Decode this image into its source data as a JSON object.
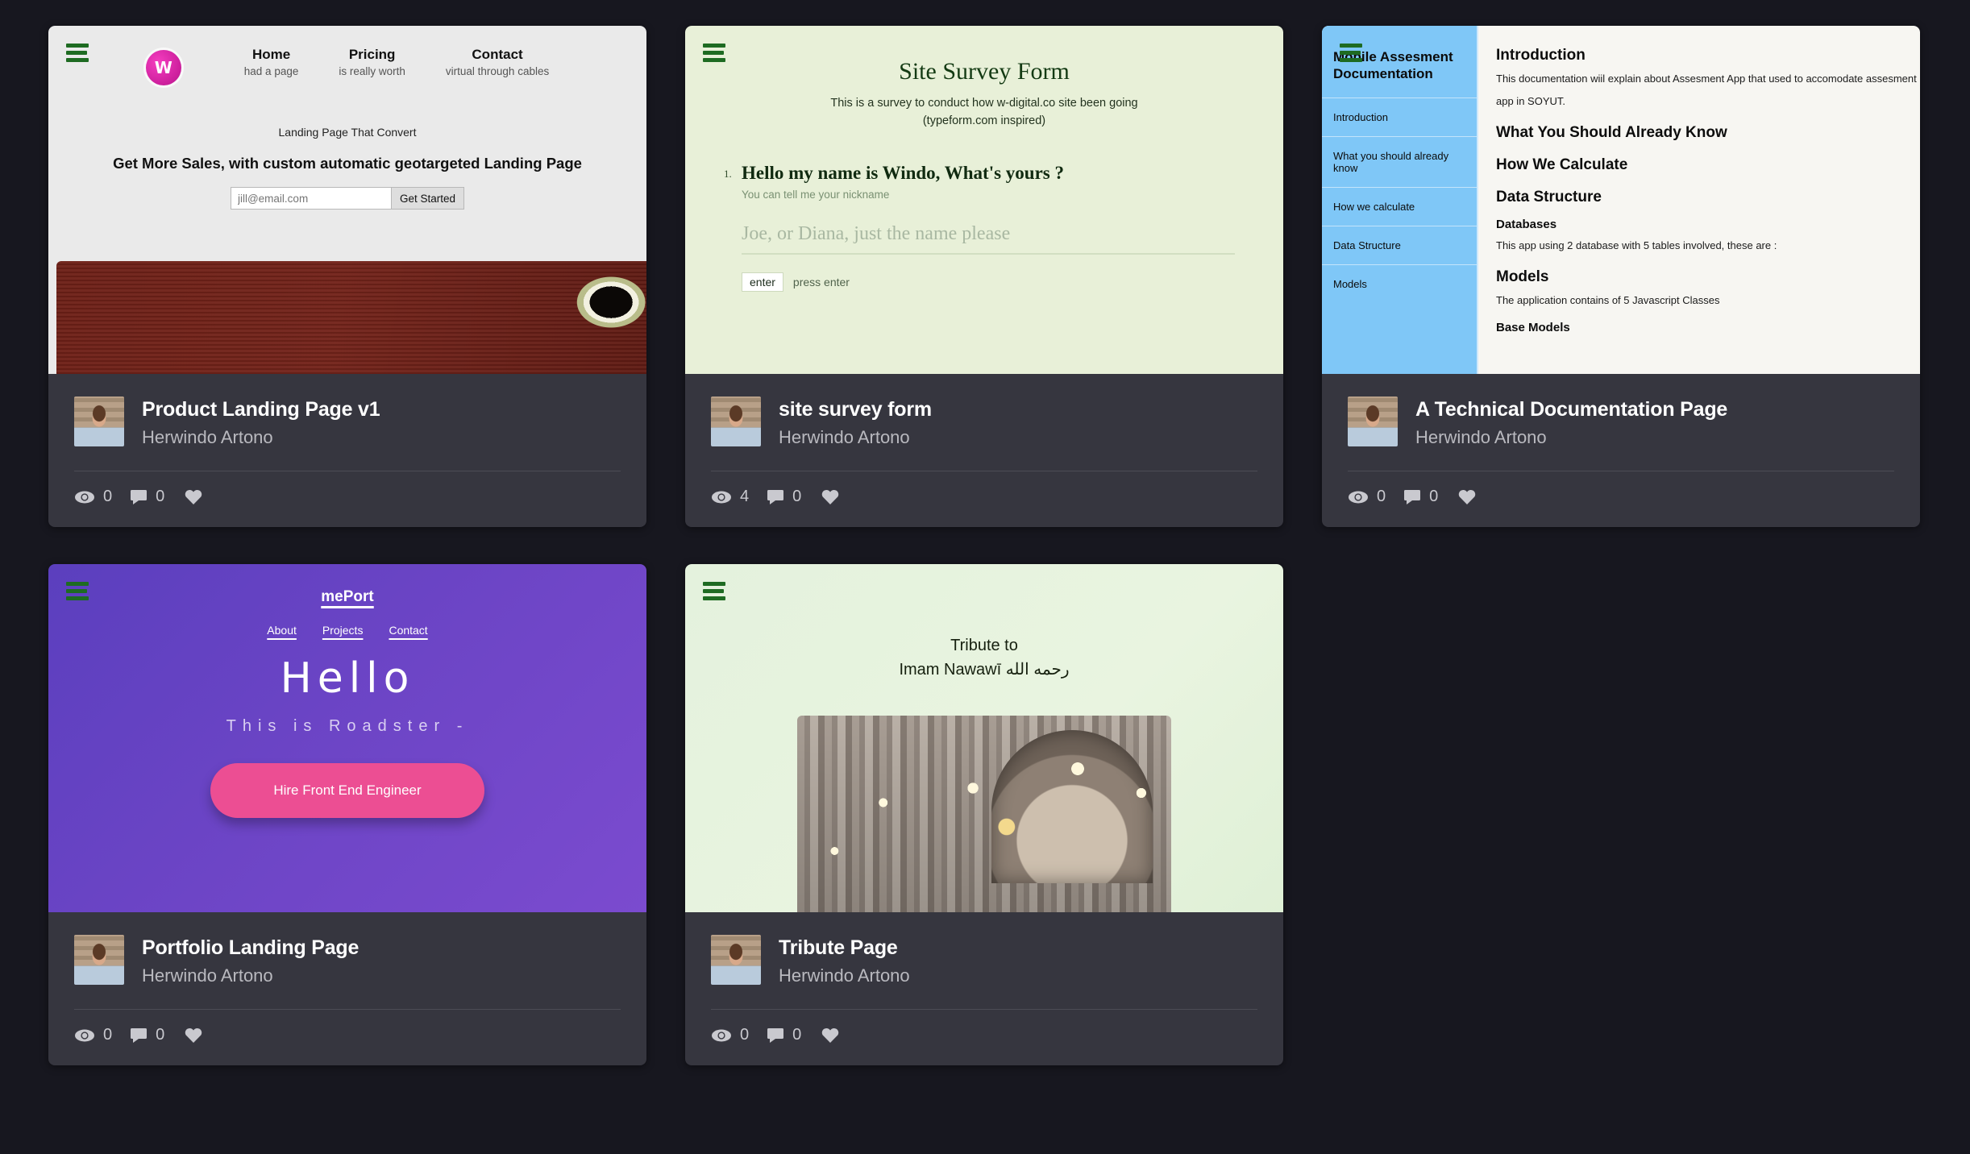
{
  "cards": [
    {
      "id": "product-landing-page-v1",
      "preview": {
        "nav": [
          {
            "label": "Home",
            "sub": "had a page"
          },
          {
            "label": "Pricing",
            "sub": "is really worth"
          },
          {
            "label": "Contact",
            "sub": "virtual through cables"
          }
        ],
        "logo_letter": "W",
        "tagline": "Landing Page That Convert",
        "headline": "Get More Sales, with custom automatic geotargeted Landing Page",
        "email_placeholder": "jill@email.com",
        "cta_label": "Get Started"
      },
      "title": "Product Landing Page v1",
      "author": "Herwindo Artono",
      "views": "0",
      "comments": "0"
    },
    {
      "id": "site-survey-form",
      "preview": {
        "title": "Site Survey Form",
        "subtitle_line1": "This is a survey to conduct how w-digital.co site been going",
        "subtitle_line2": "(typeform.com inspired)",
        "question_number": "1.",
        "question": "Hello my name is Windo, What's yours ?",
        "question_hint": "You can tell me your nickname",
        "answer_placeholder": "Joe, or Diana, just the name please",
        "enter_key": "enter",
        "enter_label": "press enter"
      },
      "title": "site survey form",
      "author": "Herwindo Artono",
      "views": "4",
      "comments": "0"
    },
    {
      "id": "technical-documentation-page",
      "preview": {
        "sidebar_title": "Mobile Assesment Documentation",
        "sidebar_items": [
          "Introduction",
          "What you should already know",
          "How we calculate",
          "Data Structure",
          "Models"
        ],
        "doc_blocks": [
          {
            "style": "h1",
            "text": "Introduction"
          },
          {
            "style": "p",
            "text": "This documentation wiil explain about Assesment App that used to accomodate assesment"
          },
          {
            "style": "p2",
            "text": "app in SOYUT."
          },
          {
            "style": "h1",
            "text": "What You Should Already Know"
          },
          {
            "style": "h1",
            "text": "How We Calculate"
          },
          {
            "style": "h1",
            "text": "Data Structure"
          },
          {
            "style": "h3",
            "text": "Databases"
          },
          {
            "style": "p",
            "text": "This app using 2 database with 5 tables involved, these are :"
          },
          {
            "style": "h1",
            "text": "Models"
          },
          {
            "style": "p",
            "text": "The application contains of 5 Javascript Classes"
          },
          {
            "style": "h3",
            "text": "Base Models"
          }
        ]
      },
      "title": "A Technical Documentation Page",
      "author": "Herwindo Artono",
      "views": "0",
      "comments": "0"
    },
    {
      "id": "portfolio-landing-page",
      "preview": {
        "brand": "mePort",
        "links": [
          "About",
          "Projects",
          "Contact"
        ],
        "hello": "Hello",
        "roadster": "This is Roadster -",
        "cta_label": "Hire Front End Engineer"
      },
      "title": "Portfolio Landing Page",
      "author": "Herwindo Artono",
      "views": "0",
      "comments": "0"
    },
    {
      "id": "tribute-page",
      "preview": {
        "title_line1": "Tribute to",
        "title_line2": "Imam Nawawī رحمه الله"
      },
      "title": "Tribute Page",
      "author": "Herwindo Artono",
      "views": "0",
      "comments": "0"
    }
  ],
  "colors": {
    "page_background": "#17171f",
    "card_background": "#36363f",
    "accent_pink": "#ec4e93",
    "accent_purple": "#6d45c6",
    "accent_blue": "#7fc7f7",
    "accent_green": "#e8f0d8",
    "burger_green": "#1e6b22"
  },
  "icons": {
    "menu": "hamburger-menu-icon",
    "views": "eye-icon",
    "comments": "comment-icon",
    "likes": "heart-icon"
  }
}
